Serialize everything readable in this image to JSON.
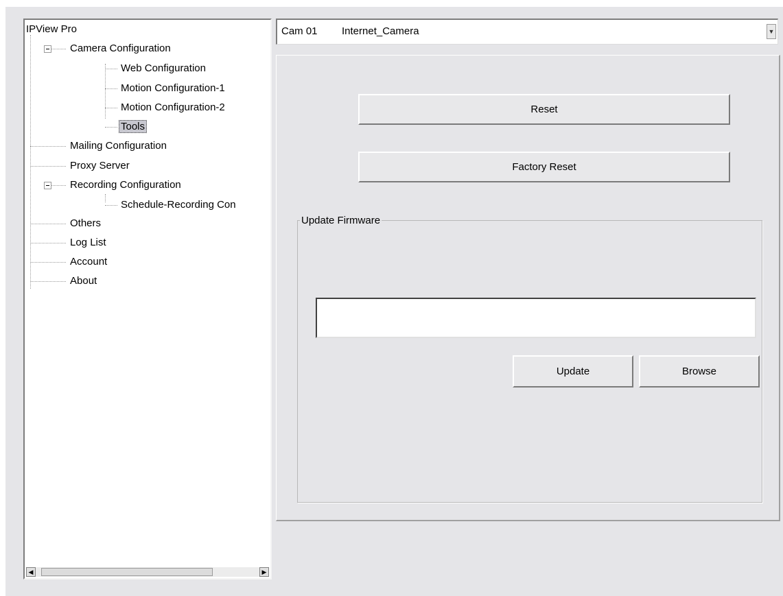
{
  "tree": {
    "root_label": "IPView Pro",
    "camera_config": {
      "label": "Camera Configuration",
      "children": [
        "Web Configuration",
        "Motion Configuration-1",
        "Motion Configuration-2",
        "Tools"
      ]
    },
    "mailing_config": "Mailing Configuration",
    "proxy_server": "Proxy Server",
    "recording_config": {
      "label": "Recording Configuration",
      "children": [
        "Schedule-Recording Con"
      ]
    },
    "others": "Others",
    "log_list": "Log List",
    "account": "Account",
    "about": "About",
    "selected": "Tools"
  },
  "camera_select": {
    "id": "Cam 01",
    "name": "Internet_Camera"
  },
  "tools": {
    "reset_label": "Reset",
    "factory_reset_label": "Factory Reset",
    "firmware_group_title": "Update Firmware",
    "firmware_path_value": "",
    "update_label": "Update",
    "browse_label": "Browse"
  }
}
